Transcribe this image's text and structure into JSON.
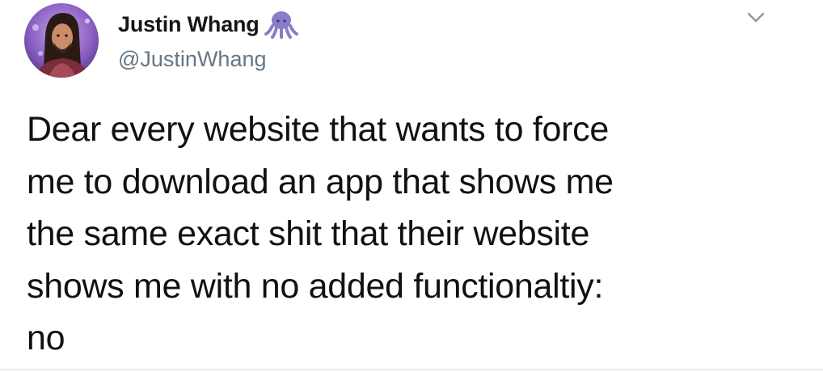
{
  "author": {
    "display_name": "Justin Whang",
    "handle": "@JustinWhang",
    "badge_icon": "octopus-icon",
    "badge_color": "#8b7cc8"
  },
  "menu": {
    "icon": "chevron-down-icon"
  },
  "tweet": {
    "lines": [
      "Dear every website that wants to force",
      "me to download an app that shows me",
      "the same exact shit that their website",
      "shows me with no added functionaltiy:",
      "no"
    ]
  },
  "colors": {
    "text": "#111111",
    "handle": "#657786",
    "background": "#ffffff"
  }
}
